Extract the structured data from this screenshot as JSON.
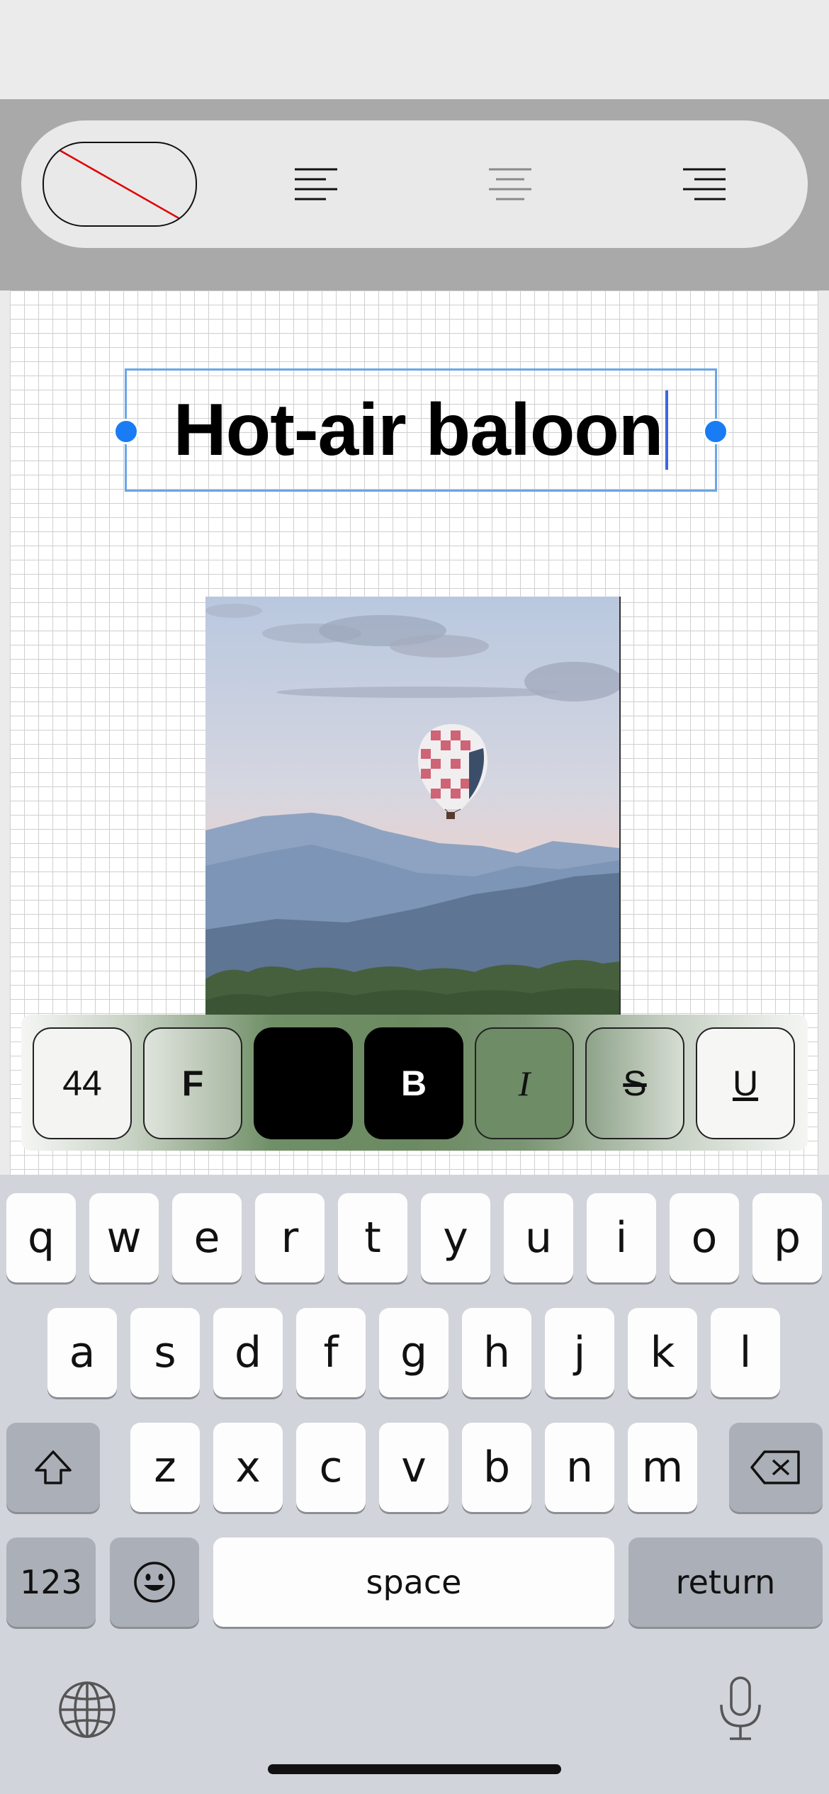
{
  "toolbar": {
    "fill_swatch": "no-fill",
    "align_left_icon": "align-left-icon",
    "align_center_icon": "align-center-icon",
    "align_right_icon": "align-right-icon"
  },
  "canvas": {
    "title_text": "Hot-air baloon"
  },
  "format_bar": {
    "font_size": "44",
    "font_button": "F",
    "bold": "B",
    "italic": "I",
    "strikethrough": "S",
    "underline": "U"
  },
  "keyboard": {
    "row1": [
      "q",
      "w",
      "e",
      "r",
      "t",
      "y",
      "u",
      "i",
      "o",
      "p"
    ],
    "row2": [
      "a",
      "s",
      "d",
      "f",
      "g",
      "h",
      "j",
      "k",
      "l"
    ],
    "row3": [
      "z",
      "x",
      "c",
      "v",
      "b",
      "n",
      "m"
    ],
    "numbers_key": "123",
    "space_key": "space",
    "return_key": "return",
    "shift_icon": "shift-icon",
    "delete_icon": "delete-icon",
    "emoji_icon": "emoji-icon",
    "globe_icon": "globe-icon",
    "mic_icon": "microphone-icon"
  },
  "colors": {
    "accent_blue": "#1a7cf5",
    "selection_border": "#6aa6e8",
    "color_swatch": "#000000"
  }
}
